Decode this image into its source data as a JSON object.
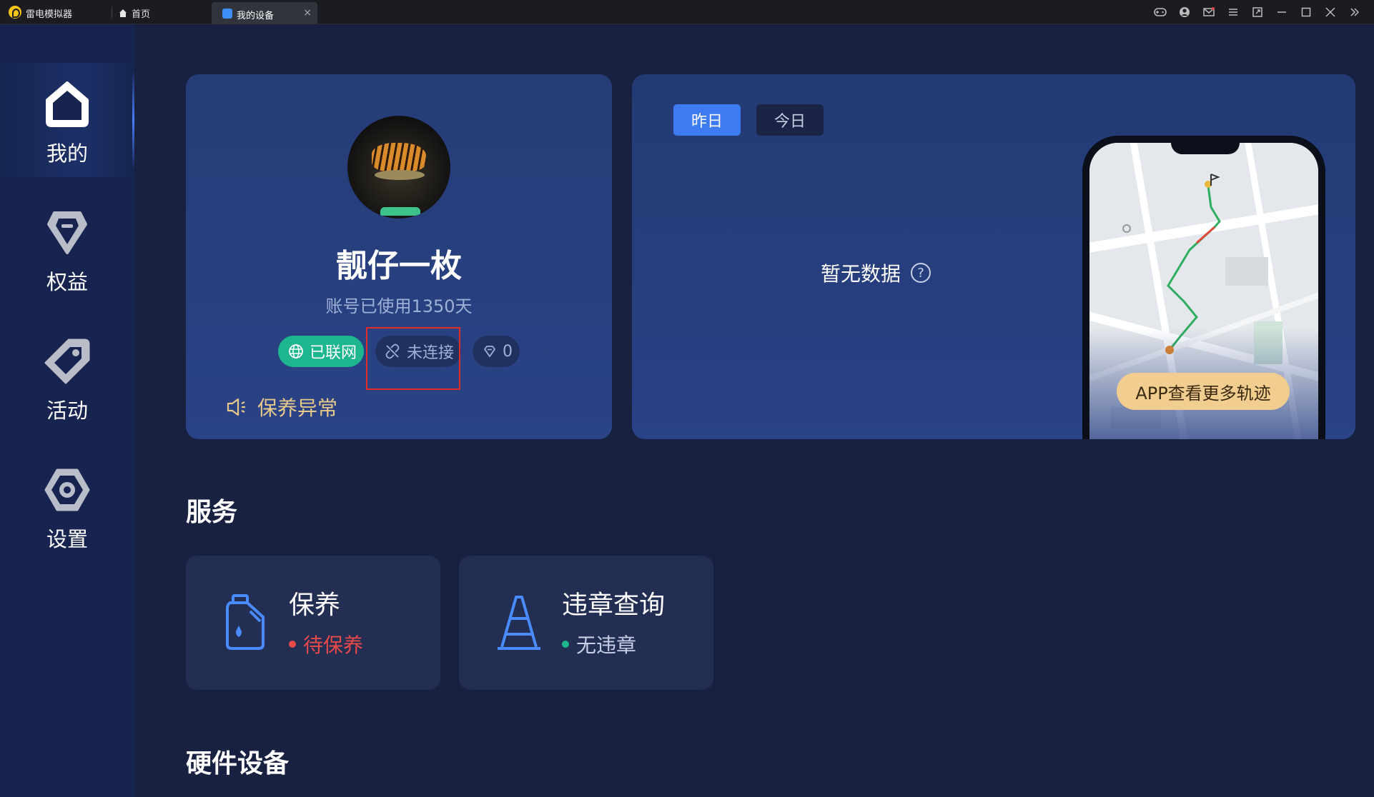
{
  "titlebar": {
    "app_name": "雷电模拟器",
    "tab_home": "首页",
    "tab_active": "我的设备",
    "tab_close": "×"
  },
  "sidebar": {
    "items": [
      {
        "label": "我的",
        "icon": "home-icon"
      },
      {
        "label": "权益",
        "icon": "diamond-shield-icon"
      },
      {
        "label": "活动",
        "icon": "tag-icon"
      },
      {
        "label": "设置",
        "icon": "gear-icon"
      }
    ]
  },
  "profile": {
    "nickname": "靓仔一枚",
    "usage": "账号已使用1350天",
    "online_label": "已联网",
    "disconnected_label": "未连接",
    "gem_count": "0",
    "maintenance_alert": "保养异常"
  },
  "trip": {
    "yesterday": "昨日",
    "today": "今日",
    "no_data": "暂无数据",
    "help": "?",
    "app_more": "APP查看更多轨迹"
  },
  "sections": {
    "services_title": "服务",
    "hardware_title": "硬件设备"
  },
  "services": [
    {
      "title": "保养",
      "status": "待保养",
      "status_color": "#e84a4a",
      "icon": "oil-can-icon"
    },
    {
      "title": "违章查询",
      "status": "无违章",
      "status_color": "#1db68f",
      "icon": "traffic-cone-icon"
    }
  ],
  "colors": {
    "accent": "#3d7bf0",
    "online": "#1db68f",
    "warning": "#e8c98a",
    "alert_box": "#e02b2b"
  }
}
